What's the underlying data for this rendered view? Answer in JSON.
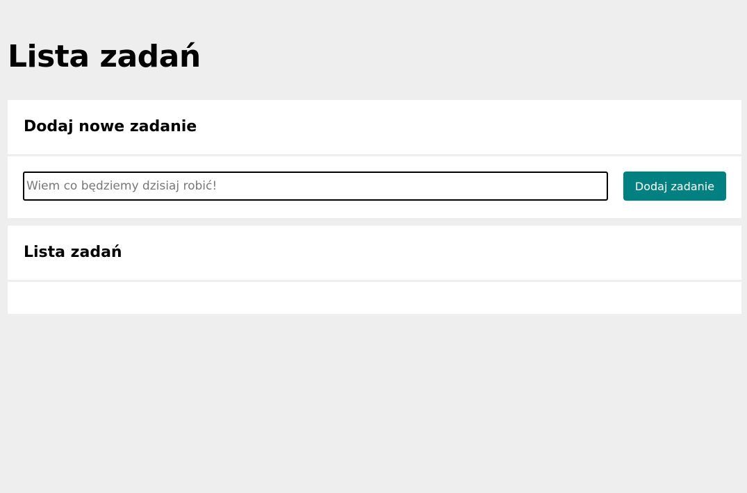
{
  "page": {
    "title": "Lista zadań"
  },
  "add_section": {
    "title": "Dodaj nowe zadanie",
    "input": {
      "value": "",
      "placeholder": "Wiem co będziemy dzisiaj robić!"
    },
    "button_label": "Dodaj zadanie"
  },
  "list_section": {
    "title": "Lista zadań",
    "items": []
  },
  "colors": {
    "background": "#eeeeee",
    "card": "#ffffff",
    "accent": "#008080",
    "text": "#000000"
  }
}
